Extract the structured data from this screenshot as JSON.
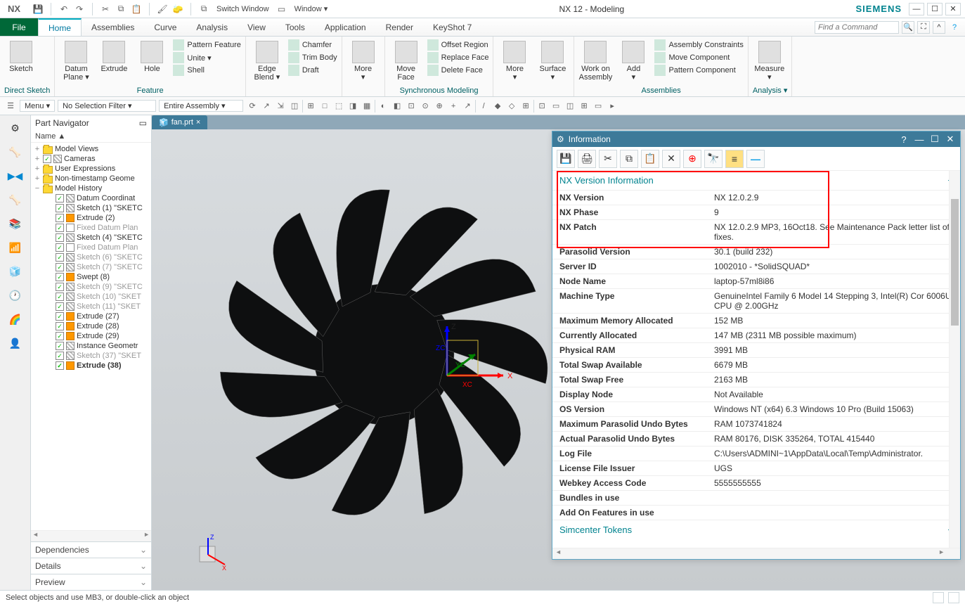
{
  "titlebar": {
    "app": "NX",
    "switch_window": "Switch Window",
    "window_menu": "Window ▾",
    "title": "NX 12 - Modeling",
    "brand": "SIEMENS"
  },
  "menu": {
    "file": "File",
    "tabs": [
      "Home",
      "Assemblies",
      "Curve",
      "Analysis",
      "View",
      "Tools",
      "Application",
      "Render",
      "KeyShot 7"
    ],
    "active": "Home",
    "search_placeholder": "Find a Command"
  },
  "ribbon": {
    "groups": [
      {
        "title": "Direct Sketch",
        "big": [
          {
            "label": "Sketch"
          }
        ]
      },
      {
        "title": "",
        "big": [
          {
            "label": "Datum\nPlane ▾"
          },
          {
            "label": "Extrude"
          },
          {
            "label": "Hole"
          }
        ],
        "mini": [
          "Pattern Feature",
          "Unite ▾",
          "Shell"
        ],
        "footer": "Feature"
      },
      {
        "title": "",
        "big": [
          {
            "label": "Edge\nBlend ▾"
          }
        ],
        "mini": [
          "Chamfer",
          "Trim Body",
          "Draft"
        ]
      },
      {
        "title": "",
        "big": [
          {
            "label": "More\n▾"
          }
        ]
      },
      {
        "title": "Synchronous Modeling",
        "big": [
          {
            "label": "Move\nFace"
          }
        ],
        "mini": [
          "Offset Region",
          "Replace Face",
          "Delete Face"
        ]
      },
      {
        "title": "",
        "big": [
          {
            "label": "More\n▾"
          },
          {
            "label": "Surface\n▾"
          }
        ]
      },
      {
        "title": "Assemblies",
        "big": [
          {
            "label": "Work on\nAssembly"
          },
          {
            "label": "Add\n▾"
          }
        ],
        "mini": [
          "Assembly Constraints",
          "Move Component",
          "Pattern Component"
        ]
      },
      {
        "title": "Analysis ▾",
        "big": [
          {
            "label": "Measure\n▾"
          }
        ]
      }
    ]
  },
  "filterbar": {
    "menu": "Menu ▾",
    "sel_filter": "No Selection Filter ▾",
    "assembly": "Entire Assembly ▾"
  },
  "nav": {
    "title": "Part Navigator",
    "col": "Name   ▲",
    "tree": [
      {
        "lvl": 0,
        "exp": "+",
        "chk": "",
        "icon": "folder",
        "text": "Model Views"
      },
      {
        "lvl": 0,
        "exp": "+",
        "chk": "✓",
        "icon": "cam",
        "text": "Cameras"
      },
      {
        "lvl": 0,
        "exp": "+",
        "chk": "",
        "icon": "folder",
        "text": "User Expressions"
      },
      {
        "lvl": 0,
        "exp": "+",
        "chk": "",
        "icon": "folder",
        "text": "Non-timestamp Geome"
      },
      {
        "lvl": 0,
        "exp": "−",
        "chk": "",
        "icon": "folder",
        "text": "Model History"
      },
      {
        "lvl": 1,
        "chk": "✓",
        "icon": "sk",
        "text": "Datum Coordinat"
      },
      {
        "lvl": 1,
        "chk": "✓",
        "icon": "sk",
        "text": "Sketch (1) \"SKETC"
      },
      {
        "lvl": 1,
        "chk": "✓",
        "icon": "box",
        "text": "Extrude (2)"
      },
      {
        "lvl": 1,
        "chk": "✓",
        "icon": "pl",
        "text": "Fixed Datum Plan",
        "muted": true
      },
      {
        "lvl": 1,
        "chk": "✓",
        "icon": "sk",
        "text": "Sketch (4) \"SKETC"
      },
      {
        "lvl": 1,
        "chk": "✓",
        "icon": "pl",
        "text": "Fixed Datum Plan",
        "muted": true
      },
      {
        "lvl": 1,
        "chk": "✓",
        "icon": "sk",
        "text": "Sketch (6) \"SKETC",
        "muted": true
      },
      {
        "lvl": 1,
        "chk": "✓",
        "icon": "sk",
        "text": "Sketch (7) \"SKETC",
        "muted": true
      },
      {
        "lvl": 1,
        "chk": "✓",
        "icon": "box",
        "text": "Swept (8)"
      },
      {
        "lvl": 1,
        "chk": "✓",
        "icon": "sk",
        "text": "Sketch (9) \"SKETC",
        "muted": true
      },
      {
        "lvl": 1,
        "chk": "✓",
        "icon": "sk",
        "text": "Sketch (10) \"SKET",
        "muted": true
      },
      {
        "lvl": 1,
        "chk": "✓",
        "icon": "sk",
        "text": "Sketch (11) \"SKET",
        "muted": true
      },
      {
        "lvl": 1,
        "chk": "✓",
        "icon": "box",
        "text": "Extrude (27)"
      },
      {
        "lvl": 1,
        "chk": "✓",
        "icon": "box",
        "text": "Extrude (28)"
      },
      {
        "lvl": 1,
        "chk": "✓",
        "icon": "box",
        "text": "Extrude (29)"
      },
      {
        "lvl": 1,
        "chk": "✓",
        "icon": "sk",
        "text": "Instance Geometr"
      },
      {
        "lvl": 1,
        "chk": "✓",
        "icon": "sk",
        "text": "Sketch (37) \"SKET",
        "muted": true
      },
      {
        "lvl": 1,
        "chk": "✓",
        "icon": "box",
        "text": "Extrude (38)",
        "bold": true
      }
    ],
    "accordions": [
      "Dependencies",
      "Details",
      "Preview"
    ]
  },
  "tab_file": "fan.prt",
  "info": {
    "title": "Information",
    "section": "NX Version Information",
    "rows": [
      {
        "k": "NX Version",
        "v": "NX 12.0.2.9"
      },
      {
        "k": "NX Phase",
        "v": "9"
      },
      {
        "k": "NX Patch",
        "v": "NX 12.0.2.9 MP3, 16Oct18. See Maintenance Pack letter list of fixes."
      },
      {
        "k": "Parasolid Version",
        "v": "30.1 (build 232)"
      },
      {
        "k": "Server ID",
        "v": "1002010 - *SolidSQUAD*"
      },
      {
        "k": "Node Name",
        "v": "laptop-57ml8i86"
      },
      {
        "k": "Machine Type",
        "v": "GenuineIntel Family 6 Model 14 Stepping 3, Intel(R) Cor 6006U CPU @ 2.00GHz"
      },
      {
        "k": "Maximum Memory Allocated",
        "v": "152 MB"
      },
      {
        "k": "Currently Allocated",
        "v": "147 MB (2311 MB possible maximum)"
      },
      {
        "k": "Physical RAM",
        "v": "3991 MB"
      },
      {
        "k": "Total Swap Available",
        "v": "6679 MB"
      },
      {
        "k": "Total Swap Free",
        "v": "2163 MB"
      },
      {
        "k": "Display Node",
        "v": "Not Available"
      },
      {
        "k": "OS Version",
        "v": "Windows NT (x64) 6.3 Windows 10 Pro (Build 15063)"
      },
      {
        "k": "Maximum Parasolid Undo Bytes",
        "v": "RAM 1073741824"
      },
      {
        "k": "Actual Parasolid Undo Bytes",
        "v": "RAM 80176, DISK 335264, TOTAL 415440"
      },
      {
        "k": "Log File",
        "v": "C:\\Users\\ADMINI~1\\AppData\\Local\\Temp\\Administrator."
      },
      {
        "k": "License File Issuer",
        "v": "UGS"
      },
      {
        "k": "Webkey Access Code",
        "v": "5555555555"
      },
      {
        "k": "Bundles in use",
        "v": ""
      },
      {
        "k": "Add On Features in use",
        "v": ""
      }
    ],
    "next_section": "Simcenter Tokens"
  },
  "status": "Select objects and use MB3, or double-click an object"
}
